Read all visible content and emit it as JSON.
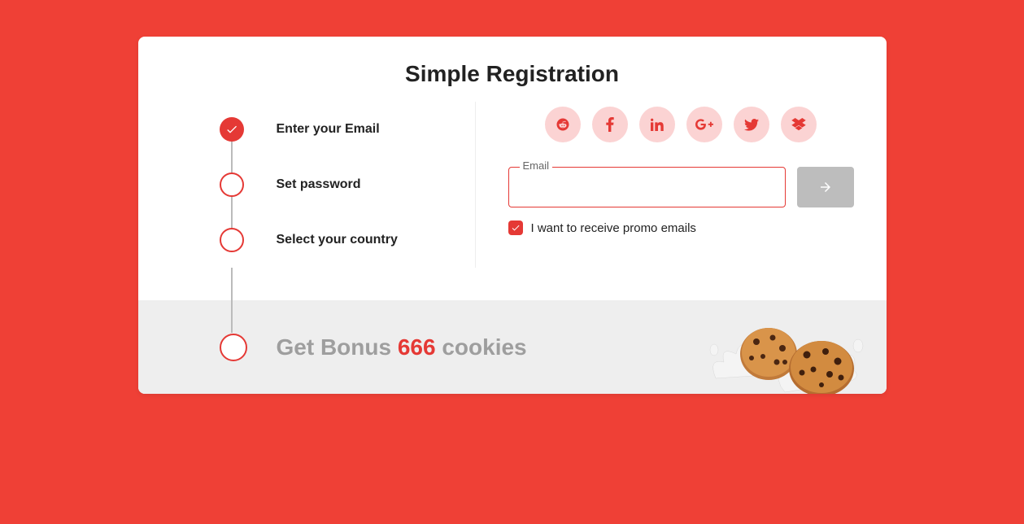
{
  "title": "Simple Registration",
  "steps": [
    {
      "label": "Enter your Email",
      "active": true
    },
    {
      "label": "Set password",
      "active": false
    },
    {
      "label": "Select your country",
      "active": false
    }
  ],
  "social": [
    {
      "name": "reddit"
    },
    {
      "name": "facebook"
    },
    {
      "name": "linkedin"
    },
    {
      "name": "google-plus"
    },
    {
      "name": "twitter"
    },
    {
      "name": "dropbox"
    }
  ],
  "email_field": {
    "label": "Email",
    "value": ""
  },
  "promo": {
    "checked": true,
    "label": "I want to receive promo emails"
  },
  "bonus": {
    "prefix": "Get Bonus ",
    "amount": "666",
    "suffix": " cookies"
  },
  "colors": {
    "accent": "#e53935",
    "bg": "#ef4036"
  }
}
